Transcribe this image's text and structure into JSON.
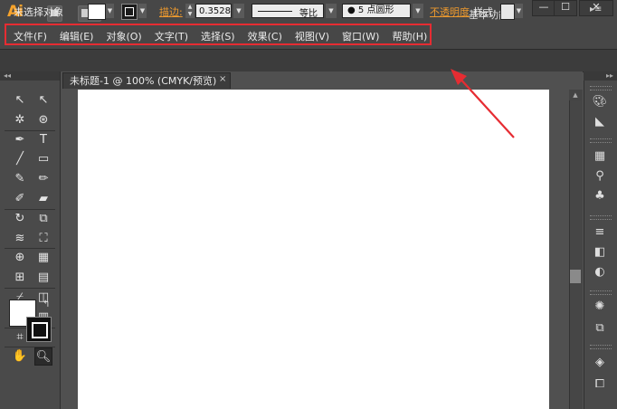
{
  "app": {
    "logo": "Ai",
    "workspace_label": "基本功能",
    "window_controls": {
      "minimize": "—",
      "maximize": "☐",
      "close": "✕"
    }
  },
  "menubar": {
    "items": [
      {
        "label": "文件(F)"
      },
      {
        "label": "编辑(E)"
      },
      {
        "label": "对象(O)"
      },
      {
        "label": "文字(T)"
      },
      {
        "label": "选择(S)"
      },
      {
        "label": "效果(C)"
      },
      {
        "label": "视图(V)"
      },
      {
        "label": "窗口(W)"
      },
      {
        "label": "帮助(H)"
      }
    ],
    "highlight_color": "#e62c32"
  },
  "controlbar": {
    "selection_status": "未选择对象",
    "stroke_label": "描边:",
    "stroke_weight": "0.3528",
    "stroke_profile": "等比",
    "brush": "5 点圆形",
    "opacity_label": "不透明度",
    "style_label": "样式:",
    "accent_color": "#ee9a2e"
  },
  "document": {
    "tab_title": "未标题-1 @ 100% (CMYK/预览)",
    "tab_close": "×"
  },
  "tools": [
    {
      "icon": "selection-tool-icon",
      "glyph": "↖"
    },
    {
      "icon": "direct-selection-tool-icon",
      "glyph": "↖"
    },
    {
      "icon": "magic-wand-tool-icon",
      "glyph": "✲"
    },
    {
      "icon": "lasso-tool-icon",
      "glyph": "⊛"
    },
    {
      "icon": "pen-tool-icon",
      "glyph": "✒"
    },
    {
      "icon": "type-tool-icon",
      "glyph": "T"
    },
    {
      "icon": "line-tool-icon",
      "glyph": "╱"
    },
    {
      "icon": "rectangle-tool-icon",
      "glyph": "▭"
    },
    {
      "icon": "paintbrush-tool-icon",
      "glyph": "✎"
    },
    {
      "icon": "pencil-tool-icon",
      "glyph": "✏"
    },
    {
      "icon": "blob-brush-tool-icon",
      "glyph": "✐"
    },
    {
      "icon": "eraser-tool-icon",
      "glyph": "▰"
    },
    {
      "icon": "rotate-tool-icon",
      "glyph": "↻"
    },
    {
      "icon": "scale-tool-icon",
      "glyph": "⧉"
    },
    {
      "icon": "warp-tool-icon",
      "glyph": "≋"
    },
    {
      "icon": "free-transform-tool-icon",
      "glyph": "⛶"
    },
    {
      "icon": "shape-builder-tool-icon",
      "glyph": "⊕"
    },
    {
      "icon": "perspective-grid-tool-icon",
      "glyph": "▦"
    },
    {
      "icon": "mesh-tool-icon",
      "glyph": "⊞"
    },
    {
      "icon": "gradient-tool-icon",
      "glyph": "▤"
    },
    {
      "icon": "eyedropper-tool-icon",
      "glyph": "⌿"
    },
    {
      "icon": "blend-tool-icon",
      "glyph": "◫"
    },
    {
      "icon": "symbol-sprayer-tool-icon",
      "glyph": "❂"
    },
    {
      "icon": "column-graph-tool-icon",
      "glyph": "▥"
    },
    {
      "icon": "artboard-tool-icon",
      "glyph": "⌗"
    },
    {
      "icon": "slice-tool-icon",
      "glyph": "⟋"
    },
    {
      "icon": "hand-tool-icon",
      "glyph": "✋"
    },
    {
      "icon": "zoom-tool-icon",
      "glyph": "🔍︎"
    }
  ],
  "right_panel": [
    {
      "icon": "color-panel-icon",
      "glyph": "🎨︎"
    },
    {
      "icon": "color-guide-panel-icon",
      "glyph": "◣"
    },
    {
      "icon": "swatches-panel-icon",
      "glyph": "▦"
    },
    {
      "icon": "brushes-panel-icon",
      "glyph": "⚲"
    },
    {
      "icon": "symbols-panel-icon",
      "glyph": "♣"
    },
    {
      "icon": "stroke-panel-icon",
      "glyph": "≡"
    },
    {
      "icon": "gradient-panel-icon",
      "glyph": "◧"
    },
    {
      "icon": "transparency-panel-icon",
      "glyph": "◐"
    },
    {
      "icon": "appearance-panel-icon",
      "glyph": "✺"
    },
    {
      "icon": "graphic-styles-panel-icon",
      "glyph": "⧉"
    },
    {
      "icon": "layers-panel-icon",
      "glyph": "◈"
    },
    {
      "icon": "artboards-panel-icon",
      "glyph": "⧠"
    }
  ]
}
